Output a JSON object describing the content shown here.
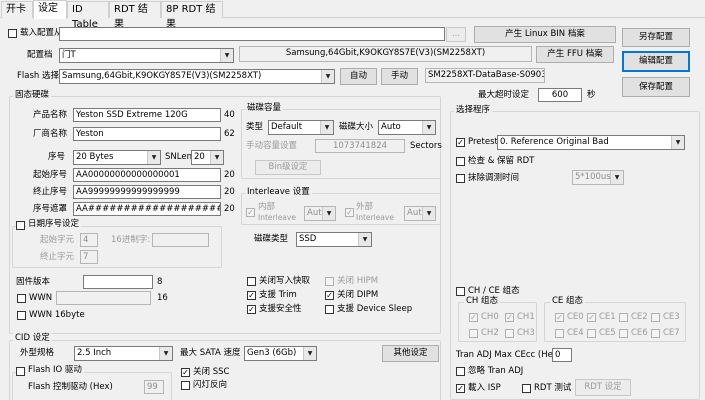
{
  "tabs": [
    "开卡",
    "设定",
    "ID Table",
    "RDT 结果",
    "8P RDT 结果"
  ],
  "top": {
    "load_config": "载入配置从",
    "browse_btn": "...",
    "gen_linux_btn": "产生 Linux BIN 档案",
    "save_as_btn": "另存配置",
    "config_label": "配置档",
    "config_value": "门T",
    "config_info": "Samsung,64Gbit,K9OKGY8S7E(V3)(SM2258XT)",
    "gen_ffu_btn": "产生 FFU 档案",
    "edit_btn": "编辑配置",
    "flash_label": "Flash 选择",
    "flash_value": "Samsung,64Gbit,K9OKGY8S7E(V3)(SM2258XT)",
    "auto_btn": "自动",
    "manual_btn": "手动",
    "db_value": "SM2258XT-DataBase-S0903",
    "timeout_label": "最大超时设定",
    "timeout_value": "600",
    "timeout_unit": "秒",
    "save_btn": "保存配置"
  },
  "fw": {
    "title": "固态硬碟",
    "product_label": "产品名称",
    "product_value": "Yeston SSD Extreme 120G",
    "product_len": "40",
    "vendor_label": "厂商名称",
    "vendor_value": "Yeston",
    "vendor_len": "62",
    "serial_label": "序号",
    "serial_value": "20 Bytes",
    "snlen_label": "SNLen",
    "snlen_value": "20",
    "start_label": "起始序号",
    "start_value": "AA00000000000000001",
    "start_len": "20",
    "end_label": "终止序号",
    "end_value": "AA99999999999999999",
    "end_len": "20",
    "mask_label": "序号遮罩",
    "mask_value": "AA####################",
    "mask_len": "20",
    "date_label": "日期序号设定",
    "start_char_label": "起始字元",
    "start_char_value": "4",
    "hex_label": "16进制字:",
    "end_char_label": "终止字元",
    "end_char_value": "7",
    "fwver_label": "固件版本",
    "fwver_len": "8",
    "wwn_label": "WWN",
    "wwn_len": "16",
    "wwn16_label": "WWN 16byte"
  },
  "cap": {
    "title": "磁碟容量",
    "type_label": "类型",
    "type_value": "Default",
    "size_label": "磁碟大小",
    "size_value": "Auto",
    "manual_label": "手动容量设置",
    "manual_value": "1073741824",
    "sectors": "Sectors",
    "bin_btn": "Bin级设定"
  },
  "inter": {
    "title": "Interleave 设置",
    "internal": "内部",
    "external": "外部",
    "word": "Interleave",
    "int_value": "Auto",
    "ext_value": "Auto"
  },
  "disk": {
    "label": "磁碟类型",
    "value": "SSD"
  },
  "opts": {
    "wcache": "关闭写入快取",
    "hipm": "关闭 HIPM",
    "trim": "支援 Trim",
    "dipm": "关闭 DIPM",
    "security": "支援安全性",
    "sleep": "支援 Device Sleep"
  },
  "cid": {
    "title": "CID 设定",
    "form_label": "外型规格",
    "form_value": "2.5 Inch",
    "sata_label": "最大 SATA 速度",
    "sata_value": "Gen3 (6Gb)",
    "other_btn": "其他设定",
    "flashio_label": "Flash IO 驱动",
    "ctrl_label": "Flash 控制驱动 (Hex)",
    "ctrl_value": "99",
    "ssc_label": "关闭 SSC",
    "led_label": "闪灯反向"
  },
  "sel": {
    "title": "选择程序",
    "pretest_label": "Pretest",
    "pretest_value": "0. Reference Original Bad",
    "check_label": "检查 & 保留 RDT",
    "erase_label": "抹除调测时间",
    "erase_value": "5*100us"
  },
  "chce": {
    "title": "CH / CE 组态",
    "ch_title": "CH 组态",
    "ch": [
      "CH0",
      "CH1",
      "CH2",
      "CH3"
    ],
    "ce_title": "CE 组态",
    "ce": [
      "CE0",
      "CE1",
      "CE2",
      "CE3",
      "CE4",
      "CE5",
      "CE6",
      "CE7"
    ]
  },
  "tran": {
    "max_label": "Tran ADJ Max CEcc (Hex)",
    "max_value": "0",
    "ignore_label": "忽略 Tran ADJ",
    "isp_label": "載入 ISP",
    "rdt_label": "RDT 测试",
    "rdt_btn": "RDT 设定"
  }
}
